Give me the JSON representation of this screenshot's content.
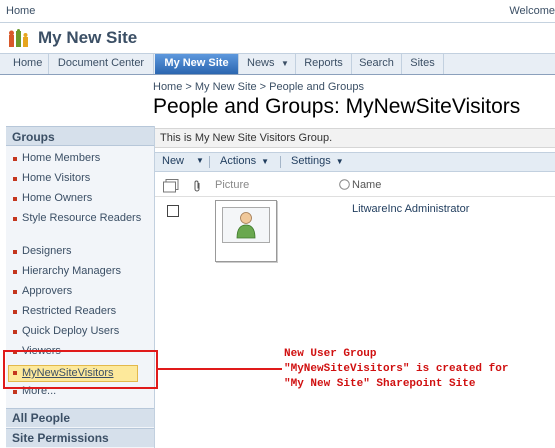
{
  "top": {
    "home": "Home",
    "welcome": "Welcome"
  },
  "site": {
    "title": "My New Site"
  },
  "nav": {
    "tabs": [
      {
        "label": "Home"
      },
      {
        "label": "Document Center"
      },
      {
        "label": "My New Site"
      },
      {
        "label": "News"
      },
      {
        "label": "Reports"
      },
      {
        "label": "Search"
      },
      {
        "label": "Sites"
      }
    ]
  },
  "breadcrumb": "Home > My New Site > People and Groups",
  "page_title": "People and Groups: MyNewSiteVisitors",
  "description": "This is My New Site Visitors Group.",
  "toolbar": {
    "new": "New",
    "actions": "Actions",
    "settings": "Settings"
  },
  "columns": {
    "picture": "Picture",
    "name": "Name"
  },
  "rows": [
    {
      "name": "LitwareInc Administrator"
    }
  ],
  "quicklaunch": {
    "header": "Groups",
    "items": [
      "Home Members",
      "Home Visitors",
      "Home Owners",
      "Style Resource Readers",
      "Designers",
      "Hierarchy Managers",
      "Approvers",
      "Restricted Readers",
      "Quick Deploy Users",
      "Viewers",
      "MyNewSiteVisitors",
      "More..."
    ],
    "sections": [
      "All People",
      "Site Permissions"
    ]
  },
  "annotation": [
    "New User Group",
    "\"MyNewSiteVisitors\" is created for",
    "\"My New Site\" Sharepoint Site"
  ],
  "colors": {
    "accent": "#2f72c0",
    "annotation": "#e01a1a",
    "highlight": "#fde99b"
  }
}
